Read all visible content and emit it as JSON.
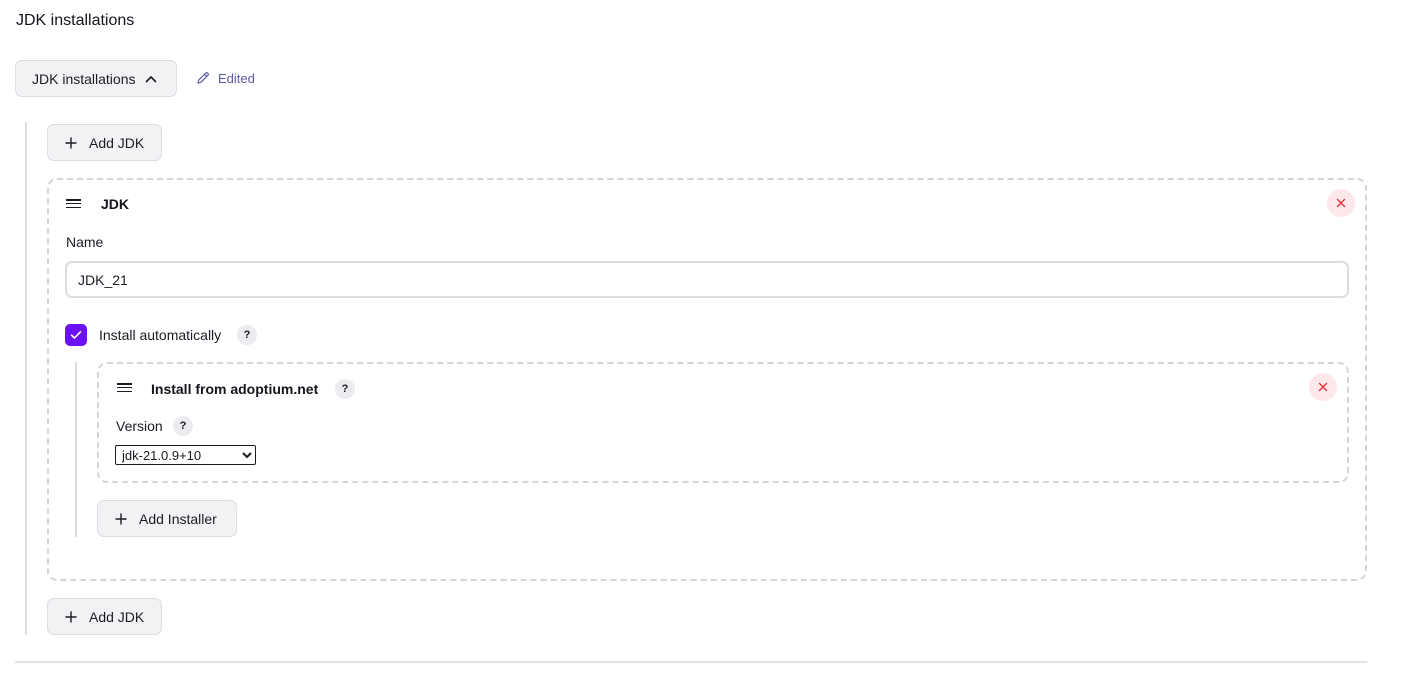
{
  "section": {
    "title": "JDK installations"
  },
  "toolbar": {
    "toggle_label": "JDK installations",
    "edited_label": "Edited"
  },
  "buttons": {
    "add_jdk_top": "Add JDK",
    "add_jdk_bottom": "Add JDK",
    "add_installer": "Add Installer"
  },
  "jdk": {
    "header": "JDK",
    "name_label": "Name",
    "name_value": "JDK_21",
    "install_auto_label": "Install automatically",
    "install_auto_checked": true
  },
  "installer": {
    "title": "Install from adoptium.net",
    "version_label": "Version",
    "version_selected": "jdk-21.0.9+10"
  },
  "help": {
    "badge": "?"
  },
  "colors": {
    "accent": "#6b12f2",
    "remove": "#e0303a",
    "edited": "#5c5ca6"
  },
  "icons": {
    "toggle": "chevron-up-icon",
    "edited": "pencil-icon",
    "add": "plus-icon",
    "drag": "drag-handle-icon",
    "remove": "close-icon",
    "check": "checkmark-icon"
  }
}
